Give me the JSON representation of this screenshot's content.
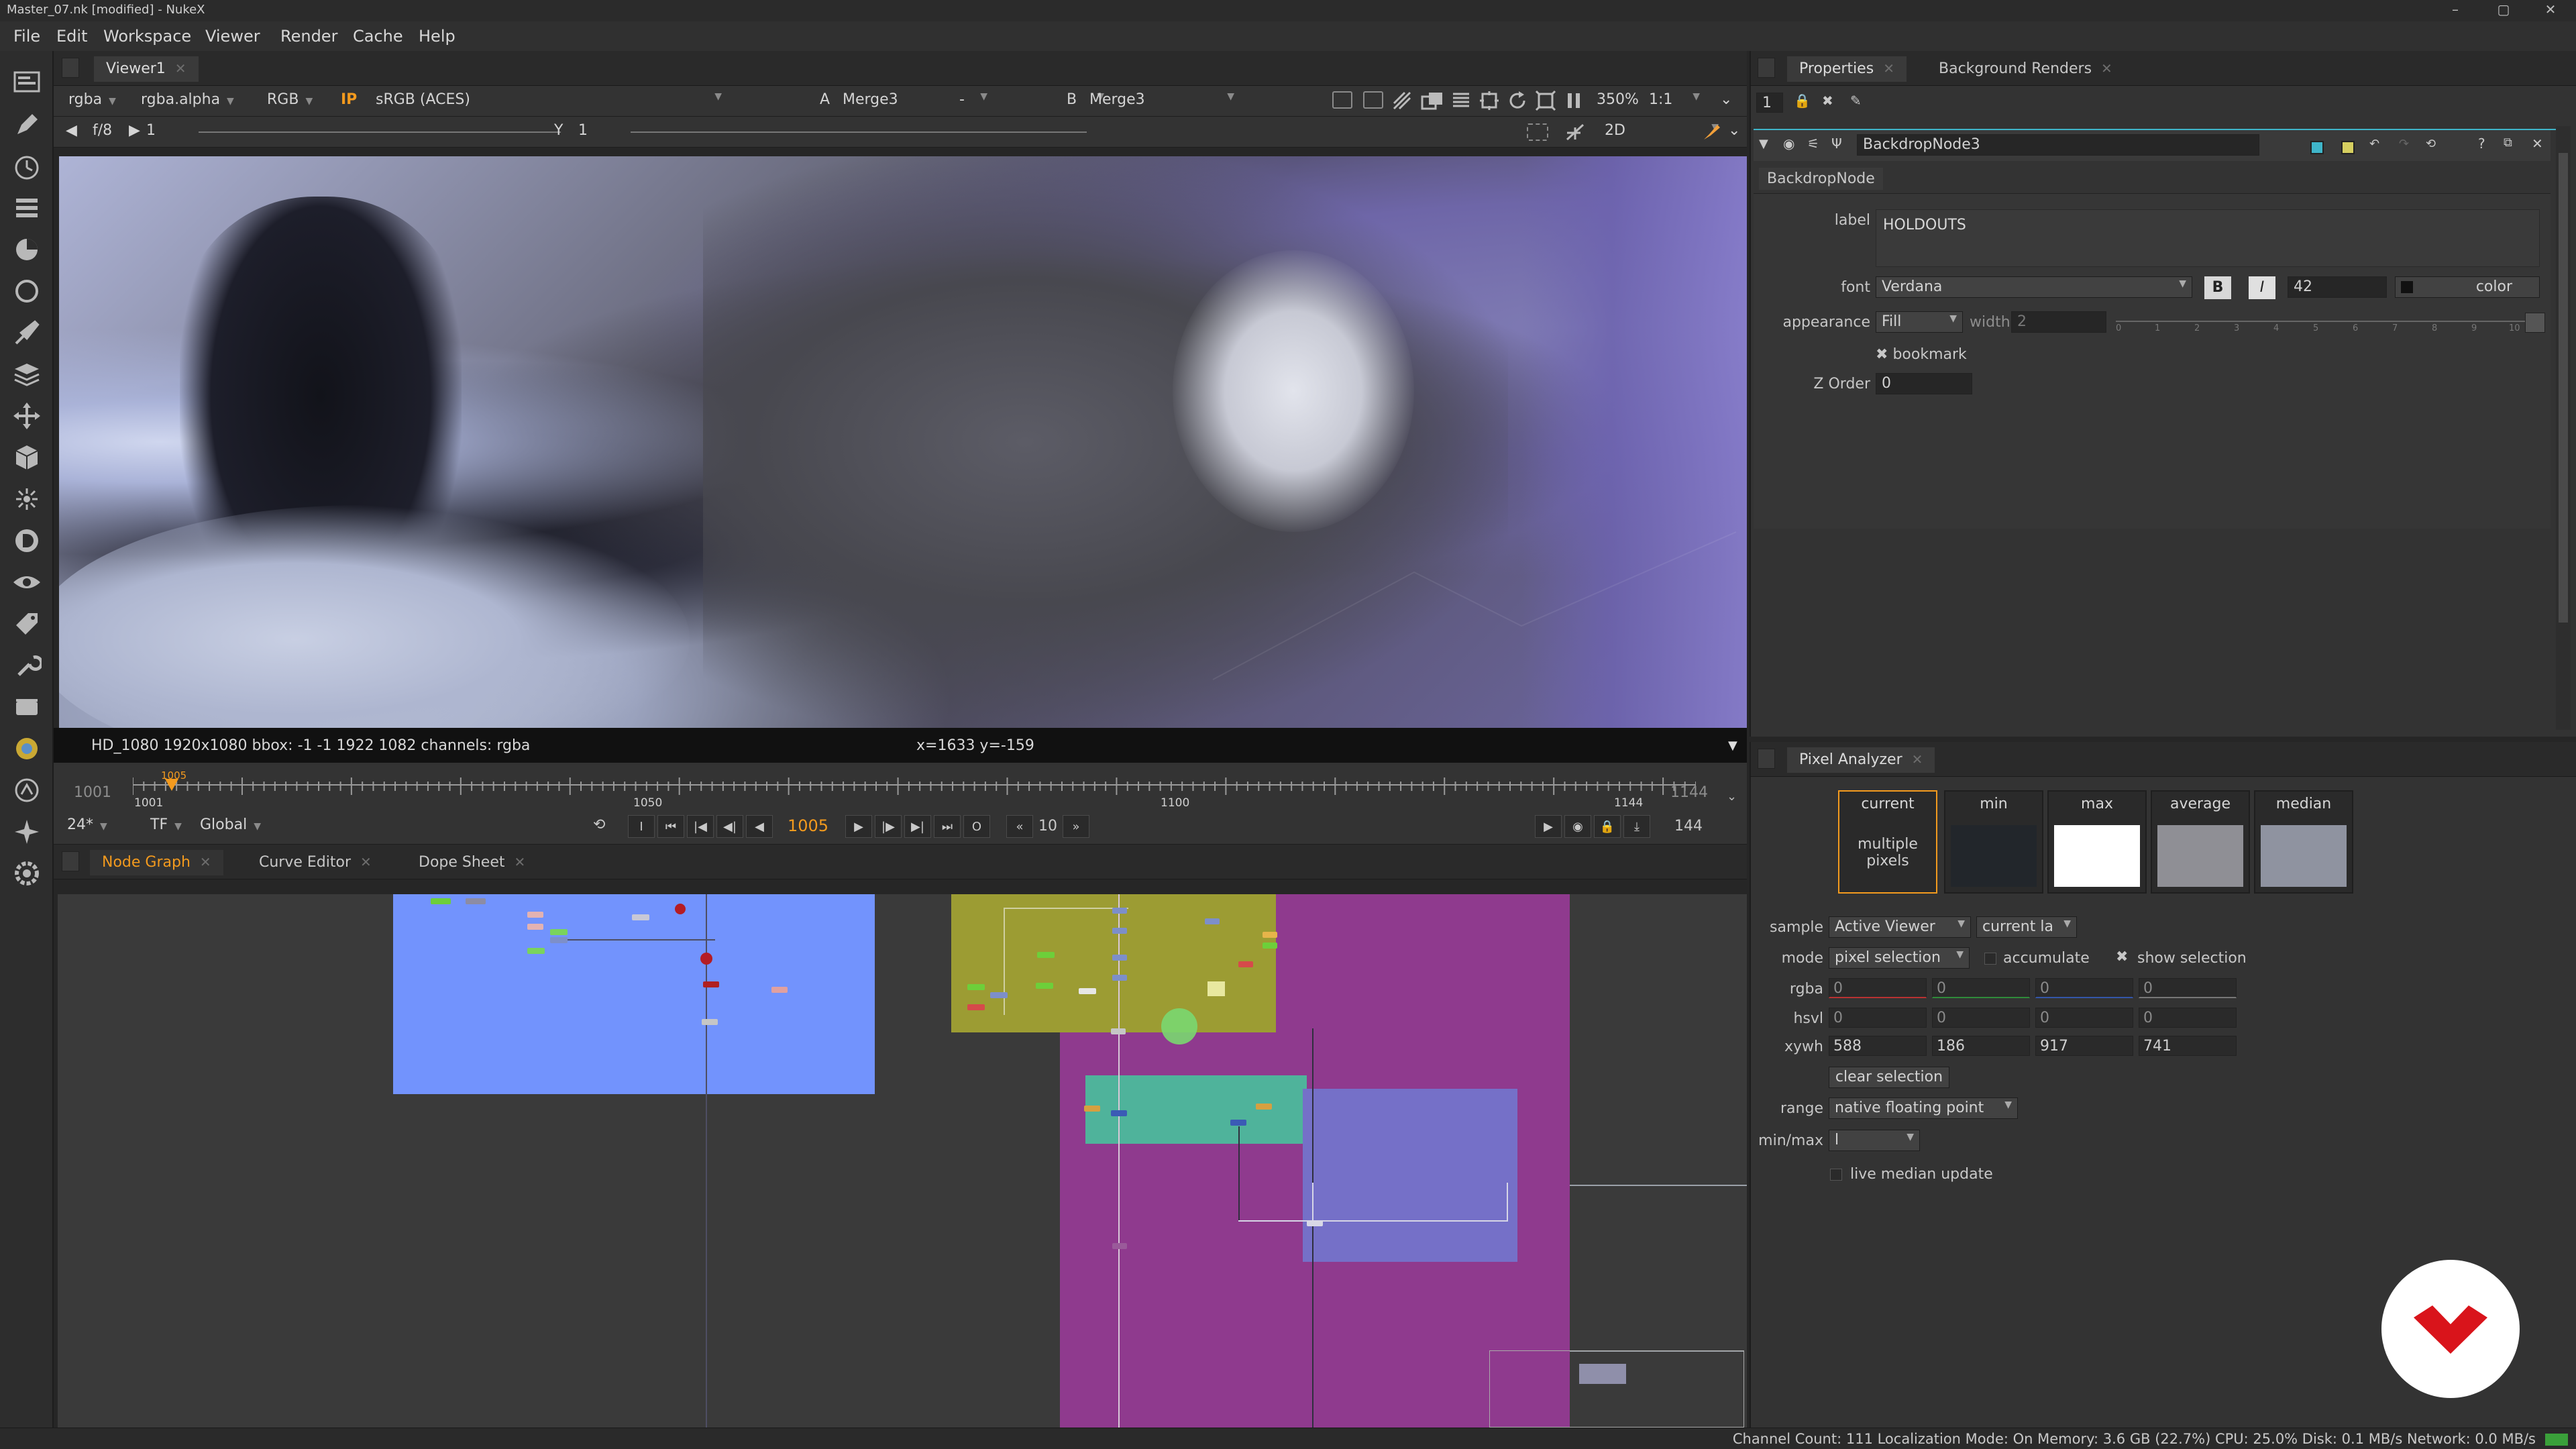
{
  "window": {
    "title": "Master_07.nk [modified] - NukeX",
    "controls": [
      "–",
      "▢",
      "✕"
    ]
  },
  "menu": [
    "File",
    "Edit",
    "Workspace",
    "Viewer",
    "Render",
    "Cache",
    "Help"
  ],
  "viewer": {
    "tab": "Viewer1",
    "channels": "rgba",
    "alpha": "rgba.alpha",
    "rgb": "RGB",
    "ip": "IP",
    "lut": "sRGB (ACES)",
    "input_a_label": "A",
    "input_a": "Merge3",
    "dash": "-",
    "input_b_label": "B",
    "input_b": "Merge3",
    "zoom": "350%",
    "ratio": "1:1",
    "fstop": "f/8",
    "gain": "1",
    "gamma_label": "Y",
    "gamma": "1",
    "mode": "2D",
    "info_format": "HD_1080 1920x1080  bbox: -1 -1 1922 1082 channels: rgba",
    "info_coords": "x=1633 y=-159"
  },
  "timeline": {
    "in_frame": "1001",
    "out_frame": "1144",
    "ticks": [
      "1001",
      "1050",
      "1100",
      "1144"
    ],
    "current_marker": "1005",
    "fps": "24*",
    "tf": "TF",
    "scope": "Global",
    "current_frame": "1005",
    "step": "10",
    "frame_count": "144"
  },
  "bottom_tabs": {
    "node_graph": "Node Graph",
    "curve_editor": "Curve Editor",
    "dope_sheet": "Dope Sheet"
  },
  "properties": {
    "tab_properties": "Properties",
    "tab_background": "Background Renders",
    "max_panels": "1",
    "node_name": "BackdropNode3",
    "node_class": "BackdropNode",
    "label_label": "label",
    "label_value": "HOLDOUTS",
    "font_label": "font",
    "font_value": "Verdana",
    "bold": "B",
    "italic": "I",
    "font_size": "42",
    "color_btn": "color",
    "appearance_label": "appearance",
    "appearance_value": "Fill",
    "width_label": "width",
    "width_value": "2",
    "slider_ticks": [
      "0",
      "1",
      "2",
      "3",
      "4",
      "5",
      "6",
      "7",
      "8",
      "9",
      "10"
    ],
    "bookmark_label": "bookmark",
    "zorder_label": "Z Order",
    "zorder_value": "0"
  },
  "pixel_analyzer": {
    "tab": "Pixel Analyzer",
    "swatches": [
      {
        "title": "current",
        "caption": "multiple pixels",
        "color": ""
      },
      {
        "title": "min",
        "caption": "",
        "color": "#22262b"
      },
      {
        "title": "max",
        "caption": "",
        "color": "#ffffff"
      },
      {
        "title": "average",
        "caption": "",
        "color": "#8f8f95"
      },
      {
        "title": "median",
        "caption": "",
        "color": "#8f93a0"
      }
    ],
    "sample_label": "sample",
    "sample_value": "Active Viewer",
    "sample_layer": "current la",
    "mode_label": "mode",
    "mode_value": "pixel selection",
    "accumulate": "accumulate",
    "show_selection": "show selection",
    "rgba_label": "rgba",
    "rgba": [
      "0",
      "0",
      "0",
      "0"
    ],
    "hsvl_label": "hsvl",
    "hsvl": [
      "0",
      "0",
      "0",
      "0"
    ],
    "xywh_label": "xywh",
    "xywh": [
      "588",
      "186",
      "917",
      "741"
    ],
    "clear_selection": "clear selection",
    "range_label": "range",
    "range_value": "native floating point",
    "minmax_label": "min/max",
    "minmax_value": "l",
    "live_median": "live median update"
  },
  "status": {
    "text": "Channel Count: 111  Localization Mode: On  Memory: 3.6 GB (22.7%)  CPU: 25.0%  Disk: 0.1 MB/s  Network: 0.0 MB/s"
  },
  "colors": {
    "accent_orange": "#f39a1e",
    "backdrop_blue": "#7293fd",
    "backdrop_olive": "#9c9c33",
    "backdrop_magenta": "#8f3a8e",
    "backdrop_teal": "#4fb39b",
    "backdrop_lavender": "#7570c8",
    "logo_red": "#d9141b"
  },
  "icons": {
    "left_toolbar": [
      "image-icon",
      "draw-icon",
      "time-icon",
      "channel-icon",
      "color-icon",
      "filter-icon",
      "keyer-icon",
      "merge-icon",
      "transform-icon",
      "3d-icon",
      "particles-icon",
      "deep-icon",
      "views-icon",
      "metadata-icon",
      "toolsets-icon",
      "other-icon",
      "furnace-icon",
      "ocula-icon",
      "cara-icon",
      "settings-icon"
    ]
  }
}
